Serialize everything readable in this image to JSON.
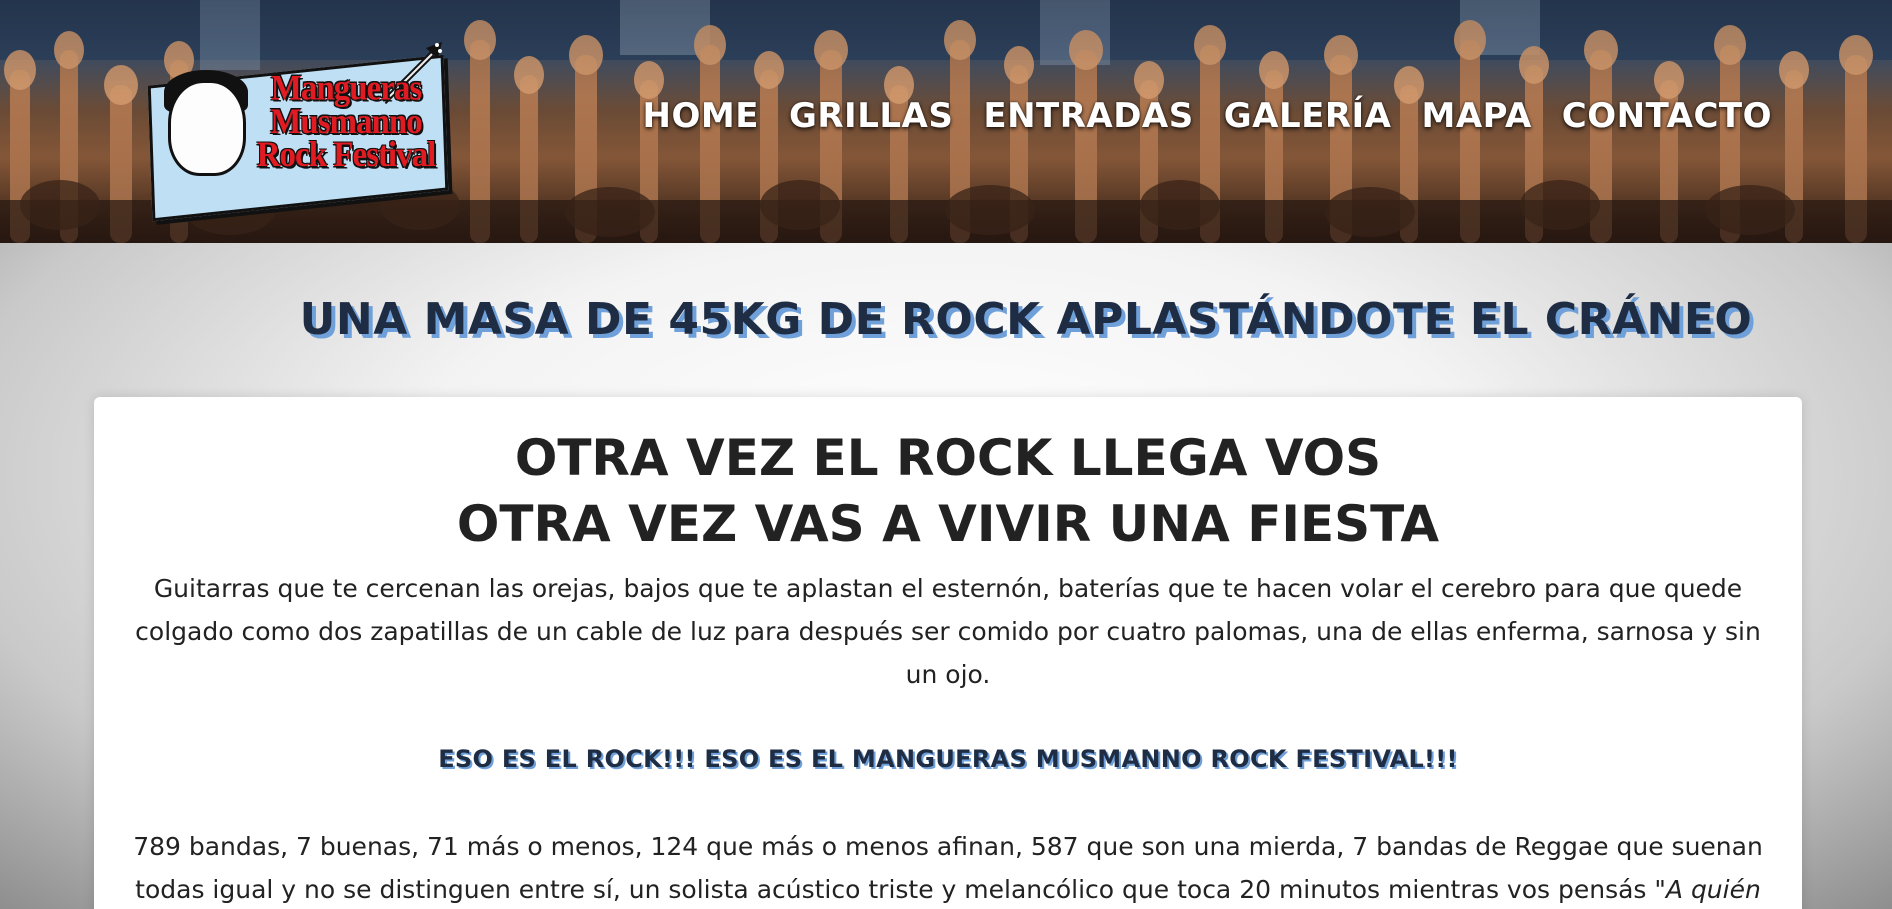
{
  "header": {
    "logo": {
      "line1": "Mangueras",
      "line2": "Musmanno",
      "line3": "Rock Festival"
    },
    "nav": {
      "items": [
        {
          "label": "HOME"
        },
        {
          "label": "GRILLAS"
        },
        {
          "label": "ENTRADAS"
        },
        {
          "label": "GALERÍA"
        },
        {
          "label": "MAPA"
        },
        {
          "label": "CONTACTO"
        }
      ]
    }
  },
  "main": {
    "tagline": "UNA MASA DE 45KG DE ROCK APLASTÁNDOTE EL CRÁNEO",
    "card": {
      "title_line1": "OTRA VEZ EL ROCK LLEGA VOS",
      "title_line2": "OTRA VEZ VAS A VIVIR UNA FIESTA",
      "paragraph1": "Guitarras que te cercenan las orejas, bajos que te aplastan el esternón, baterías que te hacen volar el cerebro para que quede colgado como dos zapatillas de un cable de luz para después ser comido por cuatro palomas, una de ellas enferma, sarnosa y sin un ojo.",
      "shout": "ESO ES EL ROCK!!! ESO ES EL MANGUERAS MUSMANNO ROCK FESTIVAL!!!",
      "paragraph2": "789 bandas, 7 buenas, 71 más o menos, 124 que más o menos afinan, 587 que son una mierda, 7 bandas de Reggae que suenan todas igual y no se distinguen entre sí, un solista acústico triste y melancólico que toca 20 minutos mientras vos pensás ",
      "paragraph2_italic": "\"A quién"
    }
  },
  "colors": {
    "accent_shadow": "#6fa0d9",
    "heading_dark": "#1f2d44",
    "logo_red": "#e11b22",
    "logo_blue": "#bfe0f4"
  }
}
